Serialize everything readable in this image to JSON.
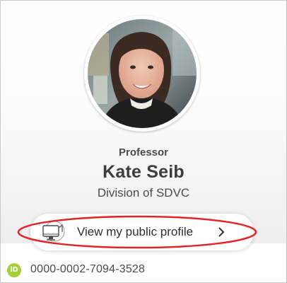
{
  "profile": {
    "title": "Professor",
    "name": "Kate Seib",
    "division": "Division of SDVC",
    "avatar_alt": "Profile photo"
  },
  "actions": {
    "view_profile_label": "View my public profile",
    "view_profile_icon": "monitor-icon",
    "chevron_icon": "chevron-right-icon"
  },
  "orcid": {
    "icon_text": "iD",
    "id": "0000-0002-7094-3528",
    "icon_color": "#a6ce39"
  },
  "colors": {
    "highlight_oval": "#e0242a"
  }
}
